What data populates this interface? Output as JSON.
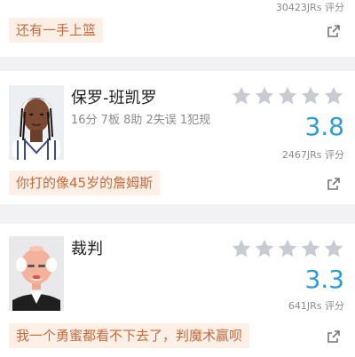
{
  "top_card": {
    "count_text": "30423JRs 评分",
    "comment": "还有一手上篮",
    "share_icon": "share-external-icon"
  },
  "cards": [
    {
      "name": "保罗-班凯罗",
      "stats": "16分 7板 8助 2失误 1犯规",
      "rating": 3.8,
      "rating_text": "3.8",
      "count_text": "2467JRs 评分",
      "comment": "你打的像45岁的詹姆斯",
      "avatar": "player-avatar",
      "share_icon": "share-external-icon"
    },
    {
      "name": "裁判",
      "stats": "",
      "rating": 3.3,
      "rating_text": "3.3",
      "count_text": "641JRs 评分",
      "comment": "我一个勇蜜都看不下去了，判魔术赢呗",
      "avatar": "referee-avatar",
      "share_icon": "share-external-icon"
    }
  ],
  "colors": {
    "score": "#2f9ad8",
    "star_empty": "#c9cbd2",
    "comment_bg": "#fbefe6",
    "comment_text": "#c66a3c"
  }
}
